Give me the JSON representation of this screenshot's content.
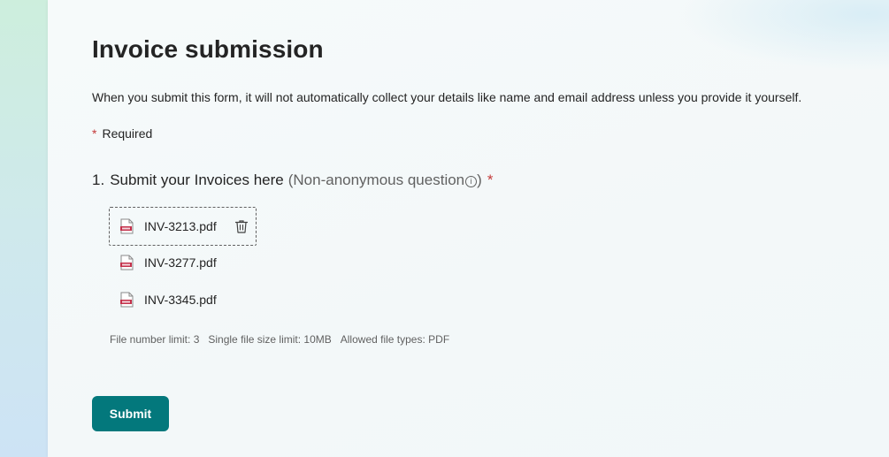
{
  "form": {
    "title": "Invoice submission",
    "description": "When you submit this form, it will not automatically collect your details like name and email address unless you provide it yourself.",
    "required_marker": "*",
    "required_label": "Required"
  },
  "question": {
    "number": "1.",
    "text": "Submit your Invoices here",
    "anonymity_note": "(Non-anonymous question",
    "info_icon_glyph": "i",
    "anonymity_note_close": ")",
    "required_marker": "*",
    "files": [
      {
        "name": "INV-3213.pdf",
        "icon": "pdf-file-icon",
        "focused": true
      },
      {
        "name": "INV-3277.pdf",
        "icon": "pdf-file-icon",
        "focused": false
      },
      {
        "name": "INV-3345.pdf",
        "icon": "pdf-file-icon",
        "focused": false
      }
    ],
    "limits": {
      "file_number": "File number limit: 3",
      "file_size": "Single file size limit: 10MB",
      "file_types": "Allowed file types: PDF"
    }
  },
  "actions": {
    "submit_label": "Submit"
  },
  "colors": {
    "accent": "#03787c",
    "required": "#c43a3a",
    "pdf_red": "#c4314b"
  }
}
